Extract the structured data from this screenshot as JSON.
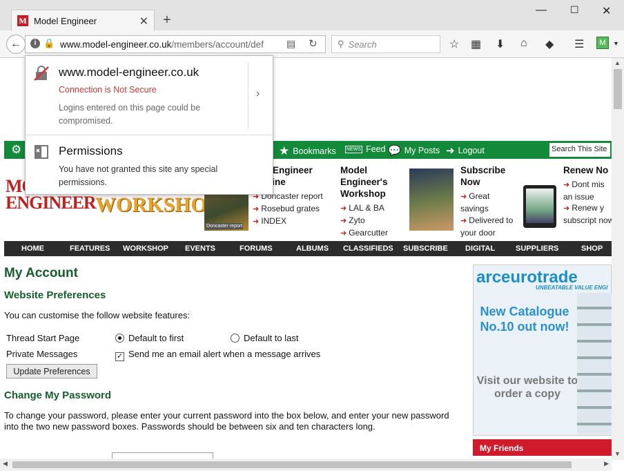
{
  "browser": {
    "tab_title": "Model Engineer",
    "favicon_letter": "M",
    "url_host": "www.model-engineer.co.uk",
    "url_path": "/members/account/def",
    "search_placeholder": "Search"
  },
  "popup": {
    "host": "www.model-engineer.co.uk",
    "warning": "Connection is Not Secure",
    "description": "Logins entered on this page could be compromised.",
    "permissions_title": "Permissions",
    "permissions_desc": "You have not granted this site any special permissions."
  },
  "greenbar": {
    "bookmarks": "Bookmarks",
    "feed": "Feed",
    "my_posts": "My Posts",
    "logout": "Logout",
    "search_site": "Search This Site"
  },
  "masthead": {
    "logo_line1": "MODEL",
    "logo_line2": "ENGINEER",
    "logo_workshop": "WORKSHOP",
    "mag_caption": "Doncaster report",
    "col1": {
      "title": "el Engineer azine",
      "items": [
        "Doncaster report",
        "Rosebud grates",
        "INDEX"
      ]
    },
    "col2": {
      "title": "Model Engineer's Workshop",
      "items": [
        "LAL & BA",
        "Zyto",
        "Gearcutter"
      ]
    },
    "col3": {
      "title": "Subscribe Now",
      "items": [
        "Great savings",
        "Delivered to your door"
      ]
    },
    "col4": {
      "title": "Renew No",
      "items": [
        "Dont mis an issue",
        "Renew y subscript now"
      ]
    }
  },
  "nav": [
    "HOME",
    "FEATURES",
    "WORKSHOP",
    "EVENTS",
    "FORUMS",
    "ALBUMS",
    "CLASSIFIEDS",
    "SUBSCRIBE",
    "DIGITAL",
    "SUPPLIERS",
    "SHOP"
  ],
  "main": {
    "page_title": "My Account",
    "prefs_title": "Website Preferences",
    "prefs_intro": "You can customise the follow website features:",
    "thread_label": "Thread Start Page",
    "thread_opt1": "Default to first",
    "thread_opt2": "Default to last",
    "pm_label": "Private Messages",
    "pm_check": "Send me an email alert when a message arrives",
    "update_btn": "Update Preferences",
    "pw_title": "Change My Password",
    "pw_text": "To change your password, please enter your current password into the box below, and enter your new password into the two new password boxes. Passwords should be between six and ten characters long."
  },
  "ad": {
    "logo": "arceurotrade",
    "tagline": "UNBEATABLE VALUE ENGI",
    "headline": "New Catalogue No.10 out now!",
    "sub": "Visit our website to order a copy"
  },
  "friends": "My Friends",
  "colors": {
    "green": "#128a3a",
    "red": "#cf1b2b",
    "dark": "#2c2c2c"
  }
}
